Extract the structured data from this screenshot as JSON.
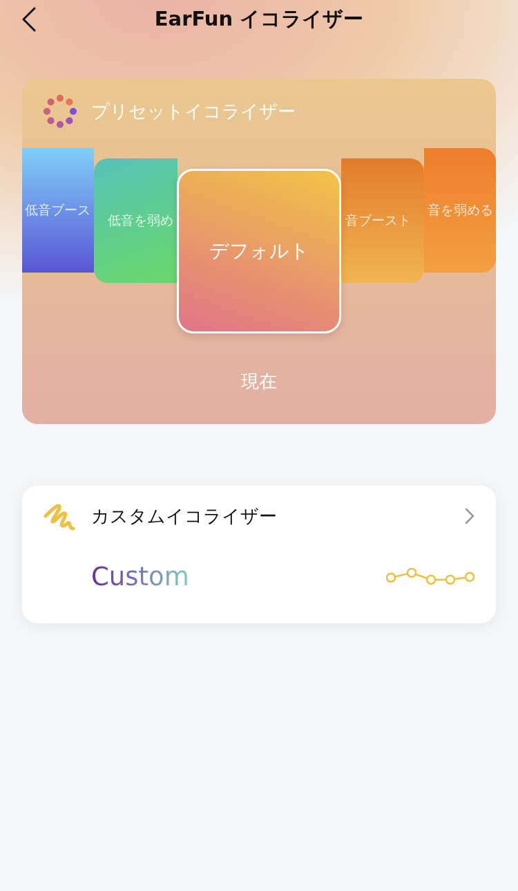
{
  "header": {
    "title": "EarFun イコライザー"
  },
  "preset_section": {
    "title": "プリセットイコライザー",
    "presets": [
      {
        "label": "低音ブース",
        "selected": false
      },
      {
        "label": "低音を弱め",
        "selected": false
      },
      {
        "label": "デフォルト",
        "selected": true
      },
      {
        "label": "音ブースト",
        "selected": false
      },
      {
        "label": "音を弱める",
        "selected": false
      }
    ],
    "current_label": "現在"
  },
  "custom_section": {
    "title": "カスタムイコライザー",
    "preset_name": "Custom"
  }
}
